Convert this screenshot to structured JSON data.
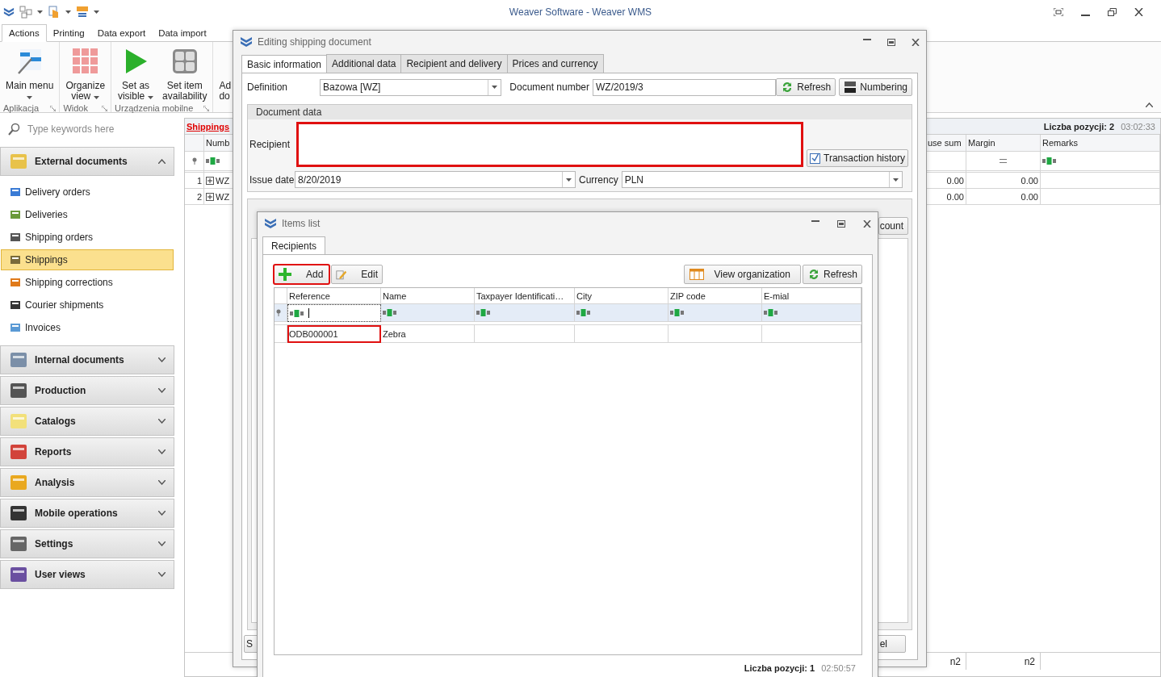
{
  "app": {
    "title": "Weaver Software - Weaver WMS"
  },
  "ribbon": {
    "tabs": [
      {
        "label": "Actions",
        "selected": true
      },
      {
        "label": "Printing",
        "selected": false
      },
      {
        "label": "Data export",
        "selected": false
      },
      {
        "label": "Data import",
        "selected": false
      }
    ],
    "groups": [
      {
        "label": "Aplikacja",
        "buttons": [
          {
            "lines": [
              "Main menu"
            ],
            "dropdown": true
          }
        ]
      },
      {
        "label": "Widok",
        "buttons": [
          {
            "lines": [
              "Organize",
              "view"
            ],
            "dropdown": true
          }
        ]
      },
      {
        "label": "Urządzenia mobilne",
        "buttons": [
          {
            "lines": [
              "Set as",
              "visible"
            ],
            "dropdown": true
          },
          {
            "lines": [
              "Set item",
              "availability"
            ],
            "dropdown": false
          }
        ]
      }
    ],
    "cut_button": {
      "lines": [
        "Ad",
        "do"
      ]
    }
  },
  "sidebar": {
    "search": {
      "placeholder": "Type keywords here"
    },
    "groups": [
      {
        "label": "External documents",
        "expanded": true,
        "items": [
          {
            "label": "Delivery orders",
            "selected": false
          },
          {
            "label": "Deliveries",
            "selected": false
          },
          {
            "label": "Shipping orders",
            "selected": false
          },
          {
            "label": "Shippings",
            "selected": true
          },
          {
            "label": "Shipping corrections",
            "selected": false
          },
          {
            "label": "Courier shipments",
            "selected": false
          },
          {
            "label": "Invoices",
            "selected": false
          }
        ]
      },
      {
        "label": "Internal documents",
        "expanded": false
      },
      {
        "label": "Production",
        "expanded": false
      },
      {
        "label": "Catalogs",
        "expanded": false
      },
      {
        "label": "Reports",
        "expanded": false
      },
      {
        "label": "Analysis",
        "expanded": false
      },
      {
        "label": "Mobile operations",
        "expanded": false
      },
      {
        "label": "Settings",
        "expanded": false
      },
      {
        "label": "User views",
        "expanded": false
      }
    ]
  },
  "main": {
    "title": "Shippings",
    "count": "Liczba pozycji: 2",
    "time": "03:02:33",
    "columns": [
      "Numb",
      "use sum",
      "Margin",
      "Remarks"
    ],
    "rows": [
      {
        "number": "1",
        "cells": [
          "WZ",
          "0.00",
          "0.00"
        ]
      },
      {
        "number": "2",
        "cells": [
          "WZ",
          "0.00",
          "0.00"
        ]
      }
    ],
    "footer": [
      "n2",
      "n2"
    ]
  },
  "editor": {
    "title": "Editing shipping document",
    "tabs": [
      {
        "label": "Basic information",
        "selected": true
      },
      {
        "label": "Additional data",
        "selected": false
      },
      {
        "label": "Recipient and delivery",
        "selected": false
      },
      {
        "label": "Prices and currency",
        "selected": false
      }
    ],
    "definition": {
      "label": "Definition",
      "value": "Bazowa [WZ]"
    },
    "document_number": {
      "label": "Document number",
      "value": "WZ/2019/3"
    },
    "buttons": [
      "Refresh",
      "Numbering"
    ],
    "document_data": {
      "title": "Document data",
      "recipient": {
        "label": "Recipient",
        "highlighted": true
      },
      "history_button": "Transaction history",
      "issue_date": {
        "label": "Issue date",
        "value": "8/20/2019"
      },
      "currency": {
        "label": "Currency",
        "value": "PLN"
      }
    },
    "positions_button": "count",
    "footer_buttons": [
      "S",
      "el"
    ]
  },
  "items_list": {
    "title": "Items list",
    "tabs": [
      {
        "label": "Recipients",
        "selected": true
      }
    ],
    "left_buttons": [
      {
        "label": "Add",
        "highlighted": true
      },
      {
        "label": "Edit",
        "highlighted": false
      }
    ],
    "right_buttons": [
      "View organization",
      "Refresh"
    ],
    "columns": [
      "Reference",
      "Name",
      "Taxpayer Identificati…",
      "City",
      "ZIP code",
      "E-mial"
    ],
    "rows": [
      {
        "cells": [
          "ODB000001",
          "Zebra"
        ],
        "highlighted": true
      }
    ],
    "count": "Liczba pozycji: 1",
    "time": "02:50:57"
  }
}
